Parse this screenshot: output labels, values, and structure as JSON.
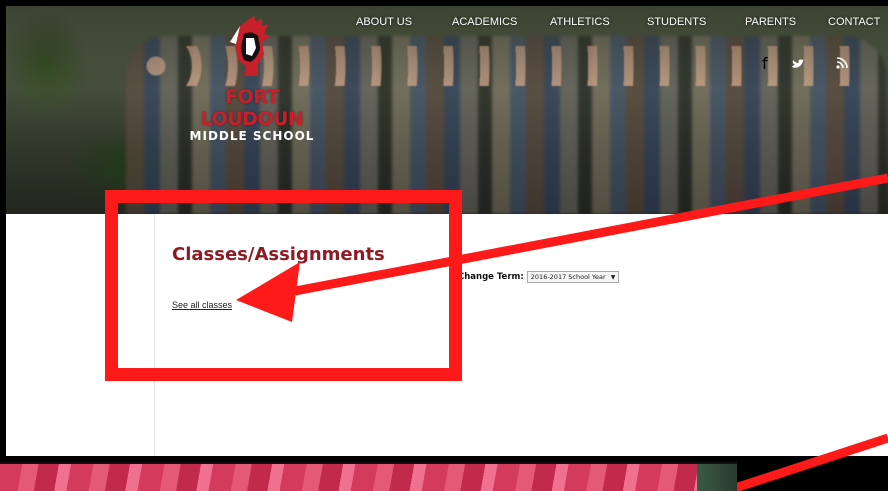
{
  "school": {
    "name_line1": "FORT LOUDOUN",
    "name_line2": "MIDDLE SCHOOL"
  },
  "nav": {
    "items": [
      {
        "label": "ABOUT US"
      },
      {
        "label": "ACADEMICS"
      },
      {
        "label": "ATHLETICS"
      },
      {
        "label": "STUDENTS"
      },
      {
        "label": "PARENTS"
      },
      {
        "label": "CONTACT"
      }
    ]
  },
  "social": {
    "facebook": "f",
    "twitter": "t",
    "rss": "r"
  },
  "main": {
    "title": "Classes/Assignments",
    "see_all_label": "See all classes",
    "term_label": "Change Term:",
    "term_value": "2016-2017 School Year"
  },
  "icons": {
    "logo": "indian-head-logo-icon",
    "dropdown": "chevron-down-icon",
    "annotation": "red-arrow-icon"
  },
  "colors": {
    "brand_red": "#8e1b22",
    "logo_red": "#c8202a",
    "annotation_red": "#ff1a1a",
    "social_red": "#b11e26"
  }
}
